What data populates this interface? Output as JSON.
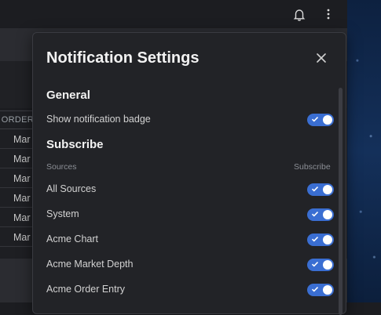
{
  "background": {
    "column_header": "ORDER",
    "rows": [
      "Mar",
      "Mar",
      "Mar",
      "Mar",
      "Mar",
      "Mar"
    ]
  },
  "dialog": {
    "title": "Notification Settings",
    "general": {
      "heading": "General",
      "items": [
        {
          "label": "Show notification badge",
          "enabled": true
        }
      ]
    },
    "subscribe": {
      "heading": "Subscribe",
      "col_sources": "Sources",
      "col_subscribe": "Subscribe",
      "items": [
        {
          "label": "All Sources",
          "enabled": true
        },
        {
          "label": "System",
          "enabled": true
        },
        {
          "label": "Acme Chart",
          "enabled": true
        },
        {
          "label": "Acme Market Depth",
          "enabled": true
        },
        {
          "label": "Acme Order Entry",
          "enabled": true
        }
      ]
    }
  },
  "icons": {
    "bell": "bell-icon",
    "more": "more-vertical-icon",
    "close": "close-icon",
    "check": "check-icon"
  },
  "colors": {
    "accent": "#3a6ed2",
    "dialog_bg": "#222327",
    "page_bg": "#1c1d21"
  }
}
